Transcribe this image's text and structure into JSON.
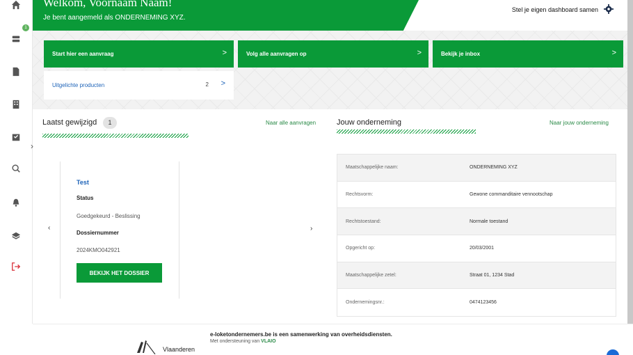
{
  "header": {
    "welcome_title": "Welkom, Voornaam Naam!",
    "welcome_sub": "Je bent aangemeld als ONDERNEMING XYZ.",
    "dashboard_link": "Stel je eigen dashboard samen"
  },
  "sidebar": {
    "badge": "1",
    "icons": [
      "home-icon",
      "stack-icon",
      "document-icon",
      "building-icon",
      "inbox-icon",
      "search-icon",
      "bell-icon",
      "layers-icon",
      "logout-icon"
    ]
  },
  "actions": {
    "start": "Start hier een aanvraag",
    "follow": "Volg alle aanvragen op",
    "inbox": "Bekijk je inbox",
    "featured": "Uitgelichte producten",
    "featured_count": "2"
  },
  "recent": {
    "title": "Laatst gewijzigd",
    "count": "1",
    "link": "Naar alle aanvragen",
    "card": {
      "name": "Test",
      "status_label": "Status",
      "status_value": "Goedgekeurd - Beslissing",
      "dossier_label": "Dossiernummer",
      "dossier_value": "2024KMO042921",
      "button": "BEKIJK HET DOSSIER"
    }
  },
  "company": {
    "title": "Jouw onderneming",
    "link": "Naar jouw onderneming",
    "rows": [
      {
        "key": "Maatschappelijke naam:",
        "value": "ONDERNEMING XYZ"
      },
      {
        "key": "Rechtsvorm:",
        "value": "Gewone commanditaire vennootschap"
      },
      {
        "key": "Rechtstoestand:",
        "value": "Normale toestand"
      },
      {
        "key": "Opgericht op:",
        "value": "20/03/2001"
      },
      {
        "key": "Maatschappelijke zetel:",
        "value": "Straat 01, 1234 Stad"
      },
      {
        "key": "Ondernemingsnr.:",
        "value": "0474123456"
      }
    ]
  },
  "footer": {
    "logo_text": "Vlaanderen",
    "main": "e-loketondernemers.be is een samenwerking van overheidsdiensten.",
    "sub_prefix": "Met ondersteuning van",
    "sub_link": "VLAIO"
  },
  "colors": {
    "primary_green": "#0a9a38",
    "link_blue": "#1d63b8"
  }
}
